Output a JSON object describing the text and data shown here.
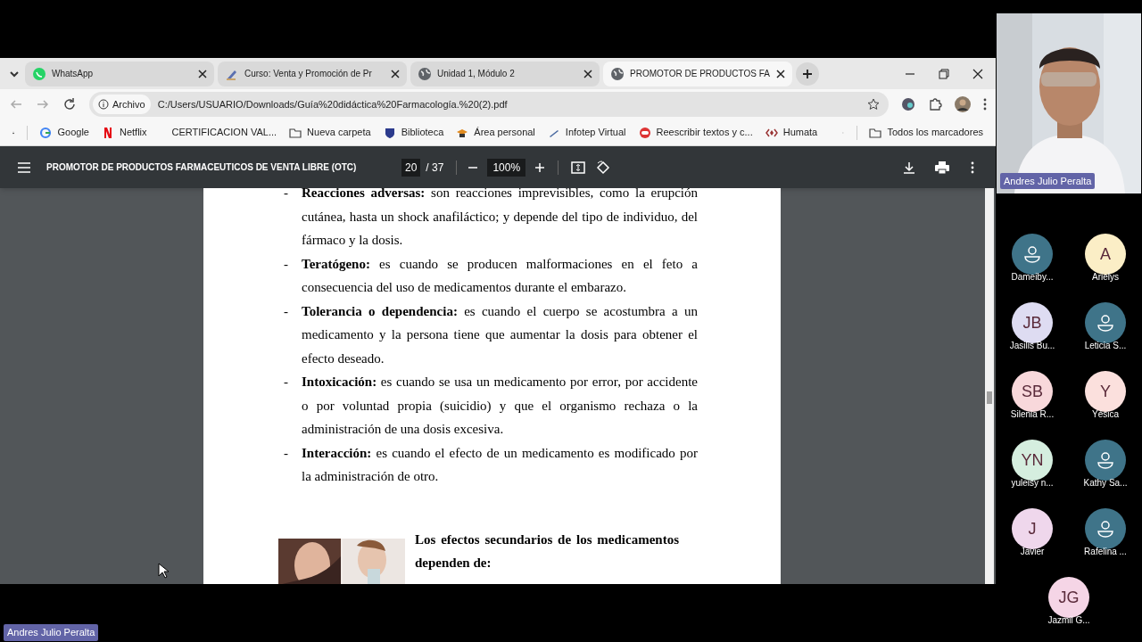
{
  "browser": {
    "tabs": [
      {
        "title": "WhatsApp",
        "selected": false
      },
      {
        "title": "Curso: Venta y Promoción de Pr",
        "selected": false
      },
      {
        "title": "Unidad 1, Módulo 2",
        "selected": false
      },
      {
        "title": "PROMOTOR DE PRODUCTOS FA",
        "selected": true
      }
    ],
    "address": {
      "badge": "Archivo",
      "url": "C:/Users/USUARIO/Downloads/Guía%20didáctica%20Farmacología.%20(2).pdf"
    },
    "bookmarks": [
      {
        "label": "Google"
      },
      {
        "label": "Netflix"
      },
      {
        "label": "CERTIFICACION VAL..."
      },
      {
        "label": "Nueva carpeta"
      },
      {
        "label": "Biblioteca"
      },
      {
        "label": "Área personal"
      },
      {
        "label": "Infotep Virtual"
      },
      {
        "label": "Reescribir textos y c..."
      },
      {
        "label": "Humata"
      }
    ],
    "all_bookmarks": "Todos los marcadores"
  },
  "pdf": {
    "title": "PROMOTOR DE PRODUCTOS FARMACEUTICOS DE VENTA LIBRE (OTC)",
    "page": "20",
    "pages": "/ 37",
    "zoom": "100%",
    "items": [
      {
        "marker": "-",
        "text": "**Reacciones adversas:** son reacciones imprevisibles, como la erupción cutánea, hasta un shock anafiláctico; y depende del tipo de individuo, del fármaco y la dosis."
      },
      {
        "marker": "-",
        "text": "**Teratógeno:** es cuando se producen malformaciones en el feto a consecuencia del uso de medicamentos durante el embarazo."
      },
      {
        "marker": "-",
        "text": "**Tolerancia o dependencia:** es cuando el cuerpo se acostumbra a un medicamento y la persona tiene que aumentar la dosis para obtener el efecto deseado."
      },
      {
        "marker": "-",
        "text": "**Intoxicación:** es cuando se usa un medicamento por error, por accidente o por voluntad propia (suicidio) y que el organismo rechaza o la administración de una dosis excesiva."
      },
      {
        "marker": "-",
        "text": "**Interacción:** es cuando el efecto de un medicamento es modificado por la administración de otro."
      }
    ],
    "heading": "Los efectos secundarios de los medicamentos dependen de:"
  },
  "meeting": {
    "presenter": {
      "name": "Andres Julio Peralta"
    },
    "participants": [
      {
        "kind": "icon",
        "name": "Dameiby...",
        "color": "#3f7489"
      },
      {
        "kind": "initials",
        "initials": "A",
        "name": "Arielys",
        "color": "#fbeec6"
      },
      {
        "kind": "initials",
        "initials": "JB",
        "name": "Jasilis Bu...",
        "color": "#dedcf2"
      },
      {
        "kind": "icon",
        "name": "Leticia S...",
        "color": "#3f7489"
      },
      {
        "kind": "initials",
        "initials": "SB",
        "name": "Silenia R...",
        "color": "#f8d8db"
      },
      {
        "kind": "initials",
        "initials": "Y",
        "name": "Yésica",
        "color": "#fbe0dd"
      },
      {
        "kind": "initials",
        "initials": "YN",
        "name": "yuleisy n...",
        "color": "#d5eedf"
      },
      {
        "kind": "icon",
        "name": "Kathy Sa...",
        "color": "#3f7489"
      },
      {
        "kind": "initials",
        "initials": "J",
        "name": "Javier",
        "color": "#efd7ec"
      },
      {
        "kind": "icon",
        "name": "Rafelina ...",
        "color": "#3f7489"
      },
      {
        "kind": "initials",
        "initials": "JG",
        "name": "Jazmil G...",
        "color": "#f5d5e6"
      }
    ],
    "sharer": "Andres Julio Peralta"
  }
}
